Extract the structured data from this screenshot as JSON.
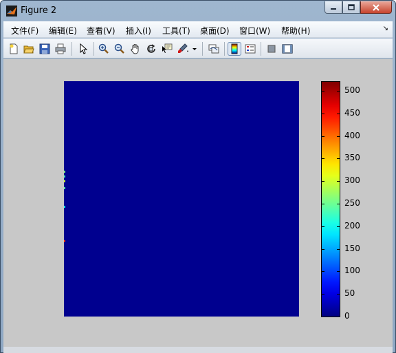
{
  "window": {
    "title": "Figure 2",
    "buttons": {
      "minimize": "minimize",
      "maximize": "maximize",
      "close": "close"
    }
  },
  "menubar": {
    "items": [
      "文件(F)",
      "编辑(E)",
      "查看(V)",
      "插入(I)",
      "工具(T)",
      "桌面(D)",
      "窗口(W)",
      "帮助(H)"
    ]
  },
  "toolbar": {
    "buttons": [
      "new-figure-icon",
      "open-file-icon",
      "save-icon",
      "print-icon",
      "pointer-icon",
      "zoom-in-icon",
      "zoom-out-icon",
      "pan-hand-icon",
      "rotate-3d-icon",
      "data-cursor-icon",
      "brush-icon",
      "link-plot-icon",
      "colorbar-icon",
      "legend-icon",
      "hide-plot-tools-icon",
      "show-plot-tools-icon"
    ],
    "pressed": "colorbar-icon"
  },
  "colormap": "jet",
  "colors": {
    "axes_background": "#00008f",
    "figure_background": "#c8c8c8"
  },
  "colorbar": {
    "ticks": [
      "0",
      "50",
      "100",
      "150",
      "200",
      "250",
      "300",
      "350",
      "400",
      "450",
      "500"
    ],
    "range": [
      0,
      520
    ]
  },
  "image": {
    "description_values": "almost all pixels ~0; a few non-zero pixels along the left edge",
    "edge_pixels": [
      {
        "value": 260,
        "row": 0.38
      },
      {
        "value": 230,
        "row": 0.4
      },
      {
        "value": 300,
        "row": 0.42
      },
      {
        "value": 240,
        "row": 0.45
      },
      {
        "value": 200,
        "row": 0.53
      },
      {
        "value": 430,
        "row": 0.675
      }
    ]
  }
}
